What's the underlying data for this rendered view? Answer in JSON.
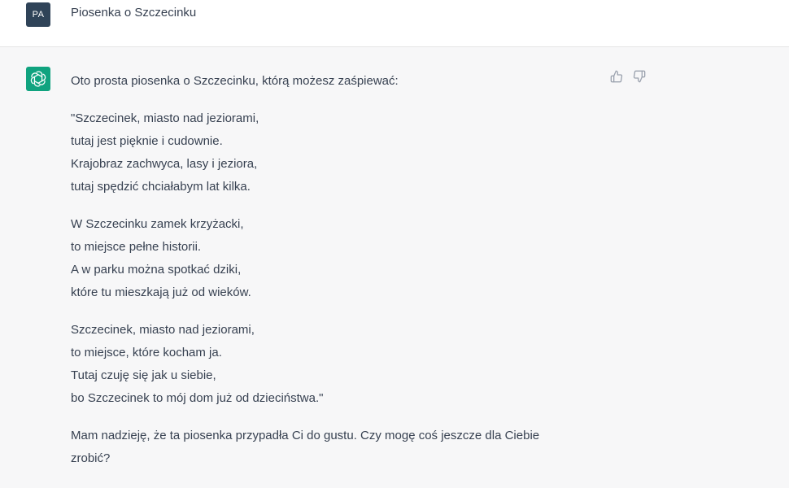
{
  "user_message": {
    "avatar_initials": "PA",
    "text": "Piosenka o Szczecinku"
  },
  "assistant_message": {
    "intro": "Oto prosta piosenka o Szczecinku, którą możesz zaśpiewać:",
    "stanzas": [
      [
        "\"Szczecinek, miasto nad jeziorami,",
        "tutaj jest pięknie i cudownie.",
        "Krajobraz zachwyca, lasy i jeziora,",
        "tutaj spędzić chciałabym lat kilka."
      ],
      [
        "W Szczecinku zamek krzyżacki,",
        "to miejsce pełne historii.",
        "A w parku można spotkać dziki,",
        "które tu mieszkają już od wieków."
      ],
      [
        "Szczecinek, miasto nad jeziorami,",
        "to miejsce, które kocham ja.",
        "Tutaj czuję się jak u siebie,",
        "bo Szczecinek to mój dom już od dzieciństwa.\""
      ]
    ],
    "closing": "Mam nadzieję, że ta piosenka przypadła Ci do gustu. Czy mogę coś jeszcze dla Ciebie zrobić?"
  },
  "icons": {
    "assistant_avatar": "openai-logo-icon",
    "like": "thumbs-up-icon",
    "dislike": "thumbs-down-icon"
  },
  "colors": {
    "user_avatar_bg": "#2f4358",
    "assistant_avatar_bg": "#10a37f",
    "assistant_row_bg": "#f7f7f8",
    "user_row_bg": "#ffffff",
    "text": "#374151"
  }
}
